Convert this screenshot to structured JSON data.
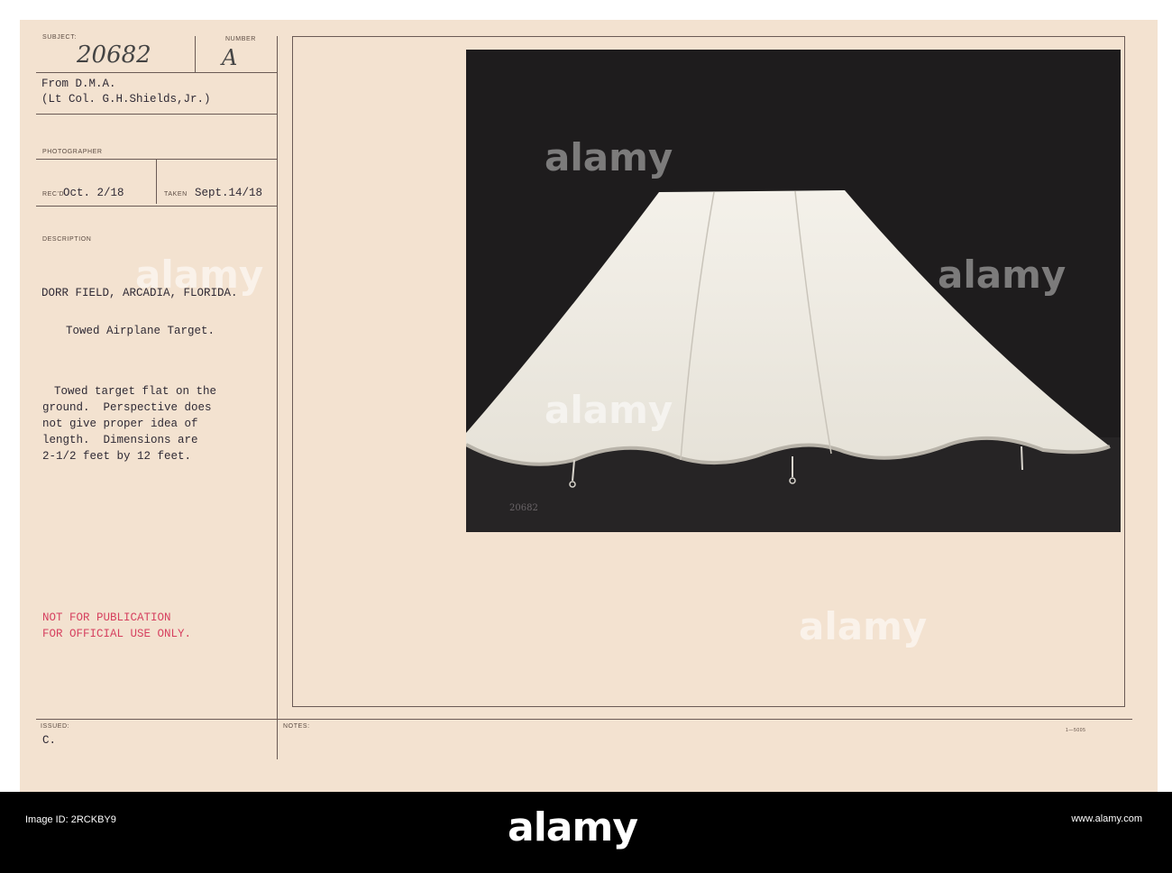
{
  "card": {
    "subject_label": "SUBJECT:",
    "subject_number": "20682",
    "number_label": "NUMBER",
    "number_value": "A",
    "from_line": "From D.M.A.",
    "from_name": "(Lt Col. G.H.Shields,Jr.)",
    "photographer_label": "PHOTOGRAPHER",
    "recd_label": "REC'D",
    "recd_value": "Oct. 2/18",
    "taken_label": "TAKEN",
    "taken_value": "Sept.14/18",
    "description_label": "DESCRIPTION",
    "location": "DORR FIELD, ARCADIA, FLORIDA.",
    "title": "Towed Airplane Target.",
    "body_lines": [
      "Towed target flat on the",
      "ground.  Perspective does",
      "not give proper idea of",
      "length.  Dimensions are",
      "2-1/2 feet by 12 feet."
    ],
    "stamp_line1": "NOT FOR PUBLICATION",
    "stamp_line2": "FOR OFFICIAL USE ONLY.",
    "issued_label": "ISSUED:",
    "issued_value": "C.",
    "notes_label": "NOTES:",
    "form_code": "1—5005",
    "photo_mark": "20682"
  },
  "watermark": {
    "brand": "alamy",
    "image_id_label": "Image ID: 2RCKBY9",
    "site": "www.alamy.com"
  },
  "colors": {
    "card": "#f3e2d0",
    "stamp_red": "#d6405f",
    "photo_bg": "#1e1c1d"
  }
}
